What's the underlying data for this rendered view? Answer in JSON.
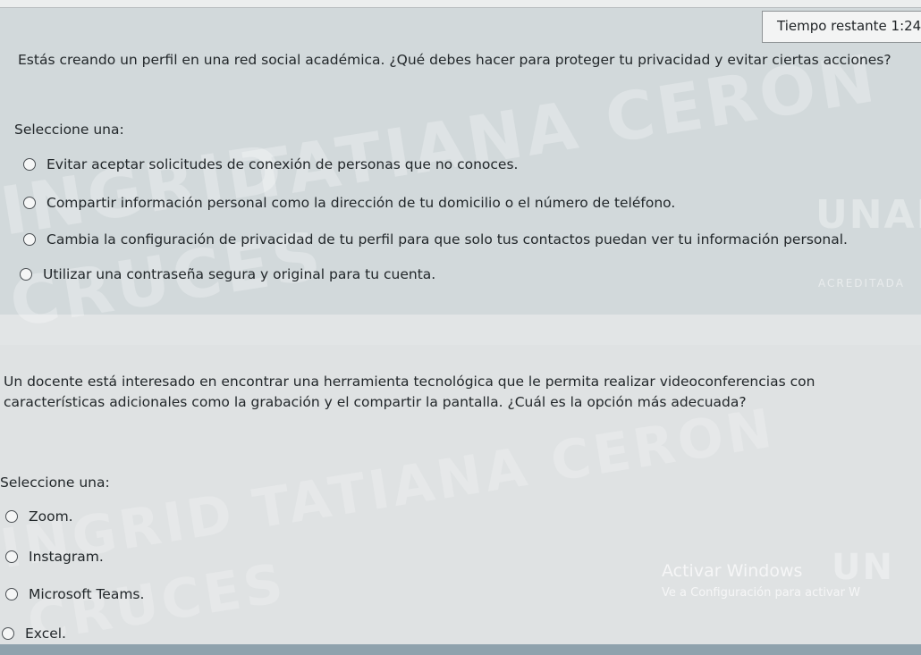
{
  "timer": {
    "label": "Tiempo restante",
    "value": "1:24"
  },
  "questions": [
    {
      "text": "Estás creando un perfil en una red social académica. ¿Qué debes hacer para proteger tu privacidad y evitar ciertas acciones?",
      "select_label": "Seleccione una:",
      "options": [
        "Evitar aceptar solicitudes de conexión de personas que no conoces.",
        "Compartir información personal como la dirección de tu domicilio o el número de teléfono.",
        "Cambia la configuración de privacidad de tu perfil para que solo tus contactos puedan ver tu información personal.",
        "Utilizar una contraseña segura y original para tu cuenta."
      ]
    },
    {
      "text_line1": "Un docente está interesado en encontrar una herramienta tecnológica que le permita realizar videoconferencias con",
      "text_line2": "características adicionales como la grabación y el compartir la pantalla. ¿Cuál es la opción más adecuada?",
      "select_label": "Seleccione una:",
      "options": [
        "Zoom.",
        "Instagram.",
        "Microsoft Teams.",
        "Excel."
      ]
    }
  ],
  "watermarks": {
    "name_top": "TATIANA CERON",
    "name_bottom": "TATIANA CERON",
    "left_top": "INGRID",
    "left_bottom": "INGRID",
    "cruces_top": "CRUCES",
    "cruces_bottom": "CRUCES",
    "logo": "UNAD",
    "logo_bottom": "UN",
    "acreditada": "ACREDITADA"
  },
  "windows_activation": {
    "title": "Activar Windows",
    "subtitle": "Ve a Configuración para activar W"
  }
}
